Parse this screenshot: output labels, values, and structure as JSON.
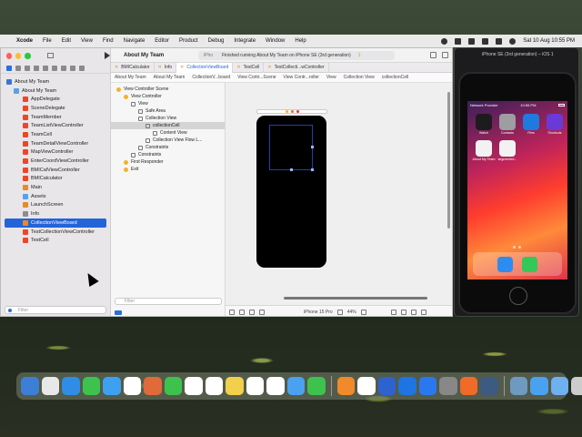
{
  "menubar": {
    "app": "Xcode",
    "items": [
      "File",
      "Edit",
      "View",
      "Find",
      "Navigate",
      "Editor",
      "Product",
      "Debug",
      "Integrate",
      "Window",
      "Help"
    ],
    "datetime": "Sat 10 Aug  10:55 PM"
  },
  "xcode": {
    "project_title": "About My Team",
    "status_device": "iPho",
    "status_text": "Finished running About My Team on iPhone SE (3rd generation)",
    "warnings": "1",
    "tabs": [
      {
        "label": "BMICalculator",
        "active": false
      },
      {
        "label": "Info",
        "active": false
      },
      {
        "label": "CollectionViewBoard",
        "active": true
      },
      {
        "label": "TestCell",
        "active": false
      },
      {
        "label": "TestCollecti...wController",
        "active": false
      }
    ],
    "jumpbar": [
      "About My Team",
      "About My Team",
      "CollectionV...board",
      "View Contr...Scene",
      "View Contr...roller",
      "View",
      "Collection View",
      "collectionCell"
    ],
    "navigator": {
      "items": [
        {
          "label": "About My Team",
          "kind": "proj",
          "indent": 6
        },
        {
          "label": "About My Team",
          "kind": "folder",
          "indent": 14
        },
        {
          "label": "AppDelegate",
          "kind": "swift",
          "indent": 24
        },
        {
          "label": "SceneDelegate",
          "kind": "swift",
          "indent": 24
        },
        {
          "label": "TeamMember",
          "kind": "swift",
          "indent": 24
        },
        {
          "label": "TeamListViewController",
          "kind": "swift",
          "indent": 24
        },
        {
          "label": "TeamCell",
          "kind": "swift",
          "indent": 24
        },
        {
          "label": "TeamDetailViewController",
          "kind": "swift",
          "indent": 24
        },
        {
          "label": "MapViewController",
          "kind": "swift",
          "indent": 24
        },
        {
          "label": "EnterCoordViewController",
          "kind": "swift",
          "indent": 24
        },
        {
          "label": "BMICalViewController",
          "kind": "swift",
          "indent": 24
        },
        {
          "label": "BMICalculator",
          "kind": "swift",
          "indent": 24
        },
        {
          "label": "Main",
          "kind": "storyicon",
          "indent": 24
        },
        {
          "label": "Assets",
          "kind": "folder",
          "indent": 24
        },
        {
          "label": "LaunchScreen",
          "kind": "storyicon",
          "indent": 24
        },
        {
          "label": "Info",
          "kind": "grey",
          "indent": 24
        },
        {
          "label": "CollectionViewBoard",
          "kind": "storyicon",
          "indent": 24,
          "selected": true
        },
        {
          "label": "TestCollectionViewController",
          "kind": "swift",
          "indent": 24
        },
        {
          "label": "TestCell",
          "kind": "swift",
          "indent": 24
        }
      ],
      "filter_placeholder": "Filter"
    },
    "outline": {
      "items": [
        {
          "label": "View Controller Scene",
          "icon": "y",
          "indent": 6
        },
        {
          "label": "View Controller",
          "icon": "y",
          "indent": 14
        },
        {
          "label": "View",
          "icon": "b",
          "indent": 22
        },
        {
          "label": "Safe Area",
          "icon": "b",
          "indent": 30
        },
        {
          "label": "Collection View",
          "icon": "b",
          "indent": 30
        },
        {
          "label": "collectionCell",
          "icon": "b",
          "indent": 38,
          "selected": true
        },
        {
          "label": "Content View",
          "icon": "b",
          "indent": 46
        },
        {
          "label": "Collection View Flow L...",
          "icon": "b",
          "indent": 38
        },
        {
          "label": "Constraints",
          "icon": "b",
          "indent": 30
        },
        {
          "label": "Constraints",
          "icon": "b",
          "indent": 22
        },
        {
          "label": "First Responder",
          "icon": "y",
          "indent": 14
        },
        {
          "label": "Exit",
          "icon": "y",
          "indent": 14
        }
      ],
      "filter_placeholder": "Filter"
    },
    "canvas": {
      "device_label": "iPhone 15 Pro",
      "zoom": "44%"
    }
  },
  "simulator": {
    "title": "iPhone SE (3rd generation) – iOS 1",
    "status_left": "Network Provider",
    "status_time": "10:55 PM",
    "apps": [
      {
        "label": "Watch",
        "color": "#1c1c1e"
      },
      {
        "label": "Contacts",
        "color": "#9d9da2"
      },
      {
        "label": "Files",
        "color": "#1f7ae0"
      },
      {
        "label": "Shortcuts",
        "color": "#6a3ad8"
      },
      {
        "label": "About My Team",
        "color": "#f2f2f2"
      },
      {
        "label": "segmented...",
        "color": "#f2f2f2"
      }
    ],
    "dock_apps": [
      "#2d8cf0",
      "#34c759"
    ]
  },
  "dock": {
    "icons": [
      "#3d7fd6",
      "#e8e8e8",
      "#2f8de4",
      "#3ec24e",
      "#3da0f0",
      "#ffffff",
      "#e06a3a",
      "#3ec24e",
      "#ffffff",
      "#ffffff",
      "#f2d04c",
      "#ffffff",
      "#ffffff",
      "#4aa1f0",
      "#3ec24e",
      "#f08a2a",
      "#ffffff",
      "#2e62d1",
      "#1e74e0",
      "#2a78f0",
      "#888888",
      "#f06a2a",
      "#3d5a80",
      "#6f9ac0",
      "#4aa1f0",
      "#6fb0f0",
      "#cccccc"
    ]
  }
}
